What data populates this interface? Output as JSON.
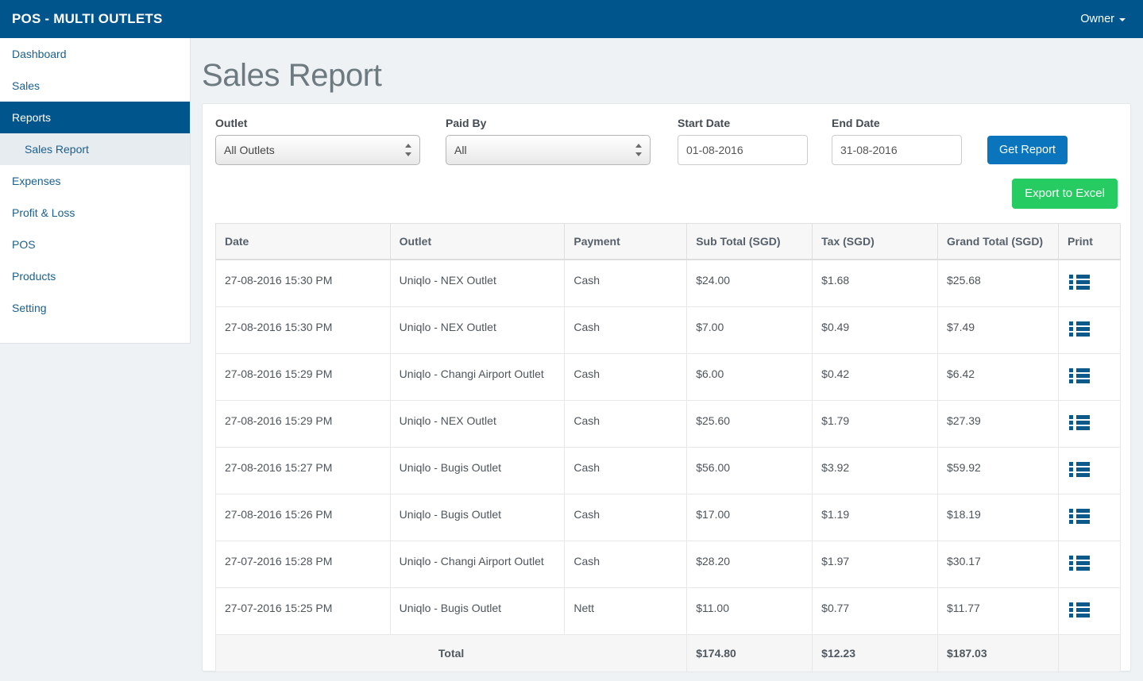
{
  "app": {
    "brand": "POS - MULTI OUTLETS",
    "user_label": "Owner",
    "brand_color": "#00558c",
    "accent_color": "#0a74bd",
    "success_color": "#26cb62",
    "icon_color": "#0b5a8a"
  },
  "sidebar": {
    "items": [
      {
        "label": "Dashboard",
        "active": false
      },
      {
        "label": "Sales",
        "active": false
      },
      {
        "label": "Reports",
        "active": true
      },
      {
        "label": "Sales Report",
        "sub": true
      },
      {
        "label": "Expenses",
        "active": false
      },
      {
        "label": "Profit & Loss",
        "active": false
      },
      {
        "label": "POS",
        "active": false
      },
      {
        "label": "Products",
        "active": false
      },
      {
        "label": "Setting",
        "active": false
      }
    ]
  },
  "page": {
    "title": "Sales Report"
  },
  "filters": {
    "outlet": {
      "label": "Outlet",
      "value": "All Outlets",
      "options": [
        "All Outlets"
      ]
    },
    "paid_by": {
      "label": "Paid By",
      "value": "All",
      "options": [
        "All"
      ]
    },
    "start_date": {
      "label": "Start Date",
      "value": "01-08-2016"
    },
    "end_date": {
      "label": "End Date",
      "value": "31-08-2016"
    },
    "get_report_label": "Get Report",
    "export_label": "Export to Excel"
  },
  "table": {
    "columns": [
      "Date",
      "Outlet",
      "Payment",
      "Sub Total (SGD)",
      "Tax (SGD)",
      "Grand Total (SGD)",
      "Print"
    ],
    "rows": [
      {
        "date": "27-08-2016 15:30 PM",
        "outlet": "Uniqlo - NEX Outlet",
        "payment": "Cash",
        "sub_total": "$24.00",
        "tax": "$1.68",
        "grand_total": "$25.68",
        "print_icon": "list-icon"
      },
      {
        "date": "27-08-2016 15:30 PM",
        "outlet": "Uniqlo - NEX Outlet",
        "payment": "Cash",
        "sub_total": "$7.00",
        "tax": "$0.49",
        "grand_total": "$7.49",
        "print_icon": "list-icon"
      },
      {
        "date": "27-08-2016 15:29 PM",
        "outlet": "Uniqlo - Changi Airport Outlet",
        "payment": "Cash",
        "sub_total": "$6.00",
        "tax": "$0.42",
        "grand_total": "$6.42",
        "print_icon": "list-icon"
      },
      {
        "date": "27-08-2016 15:29 PM",
        "outlet": "Uniqlo - NEX Outlet",
        "payment": "Cash",
        "sub_total": "$25.60",
        "tax": "$1.79",
        "grand_total": "$27.39",
        "print_icon": "list-icon"
      },
      {
        "date": "27-08-2016 15:27 PM",
        "outlet": "Uniqlo - Bugis Outlet",
        "payment": "Cash",
        "sub_total": "$56.00",
        "tax": "$3.92",
        "grand_total": "$59.92",
        "print_icon": "list-icon"
      },
      {
        "date": "27-08-2016 15:26 PM",
        "outlet": "Uniqlo - Bugis Outlet",
        "payment": "Cash",
        "sub_total": "$17.00",
        "tax": "$1.19",
        "grand_total": "$18.19",
        "print_icon": "list-icon"
      },
      {
        "date": "27-07-2016 15:28 PM",
        "outlet": "Uniqlo - Changi Airport Outlet",
        "payment": "Cash",
        "sub_total": "$28.20",
        "tax": "$1.97",
        "grand_total": "$30.17",
        "print_icon": "list-icon"
      },
      {
        "date": "27-07-2016 15:25 PM",
        "outlet": "Uniqlo - Bugis Outlet",
        "payment": "Nett",
        "sub_total": "$11.00",
        "tax": "$0.77",
        "grand_total": "$11.77",
        "print_icon": "list-icon"
      }
    ],
    "total": {
      "label": "Total",
      "sub_total": "$174.80",
      "tax": "$12.23",
      "grand_total": "$187.03"
    }
  }
}
